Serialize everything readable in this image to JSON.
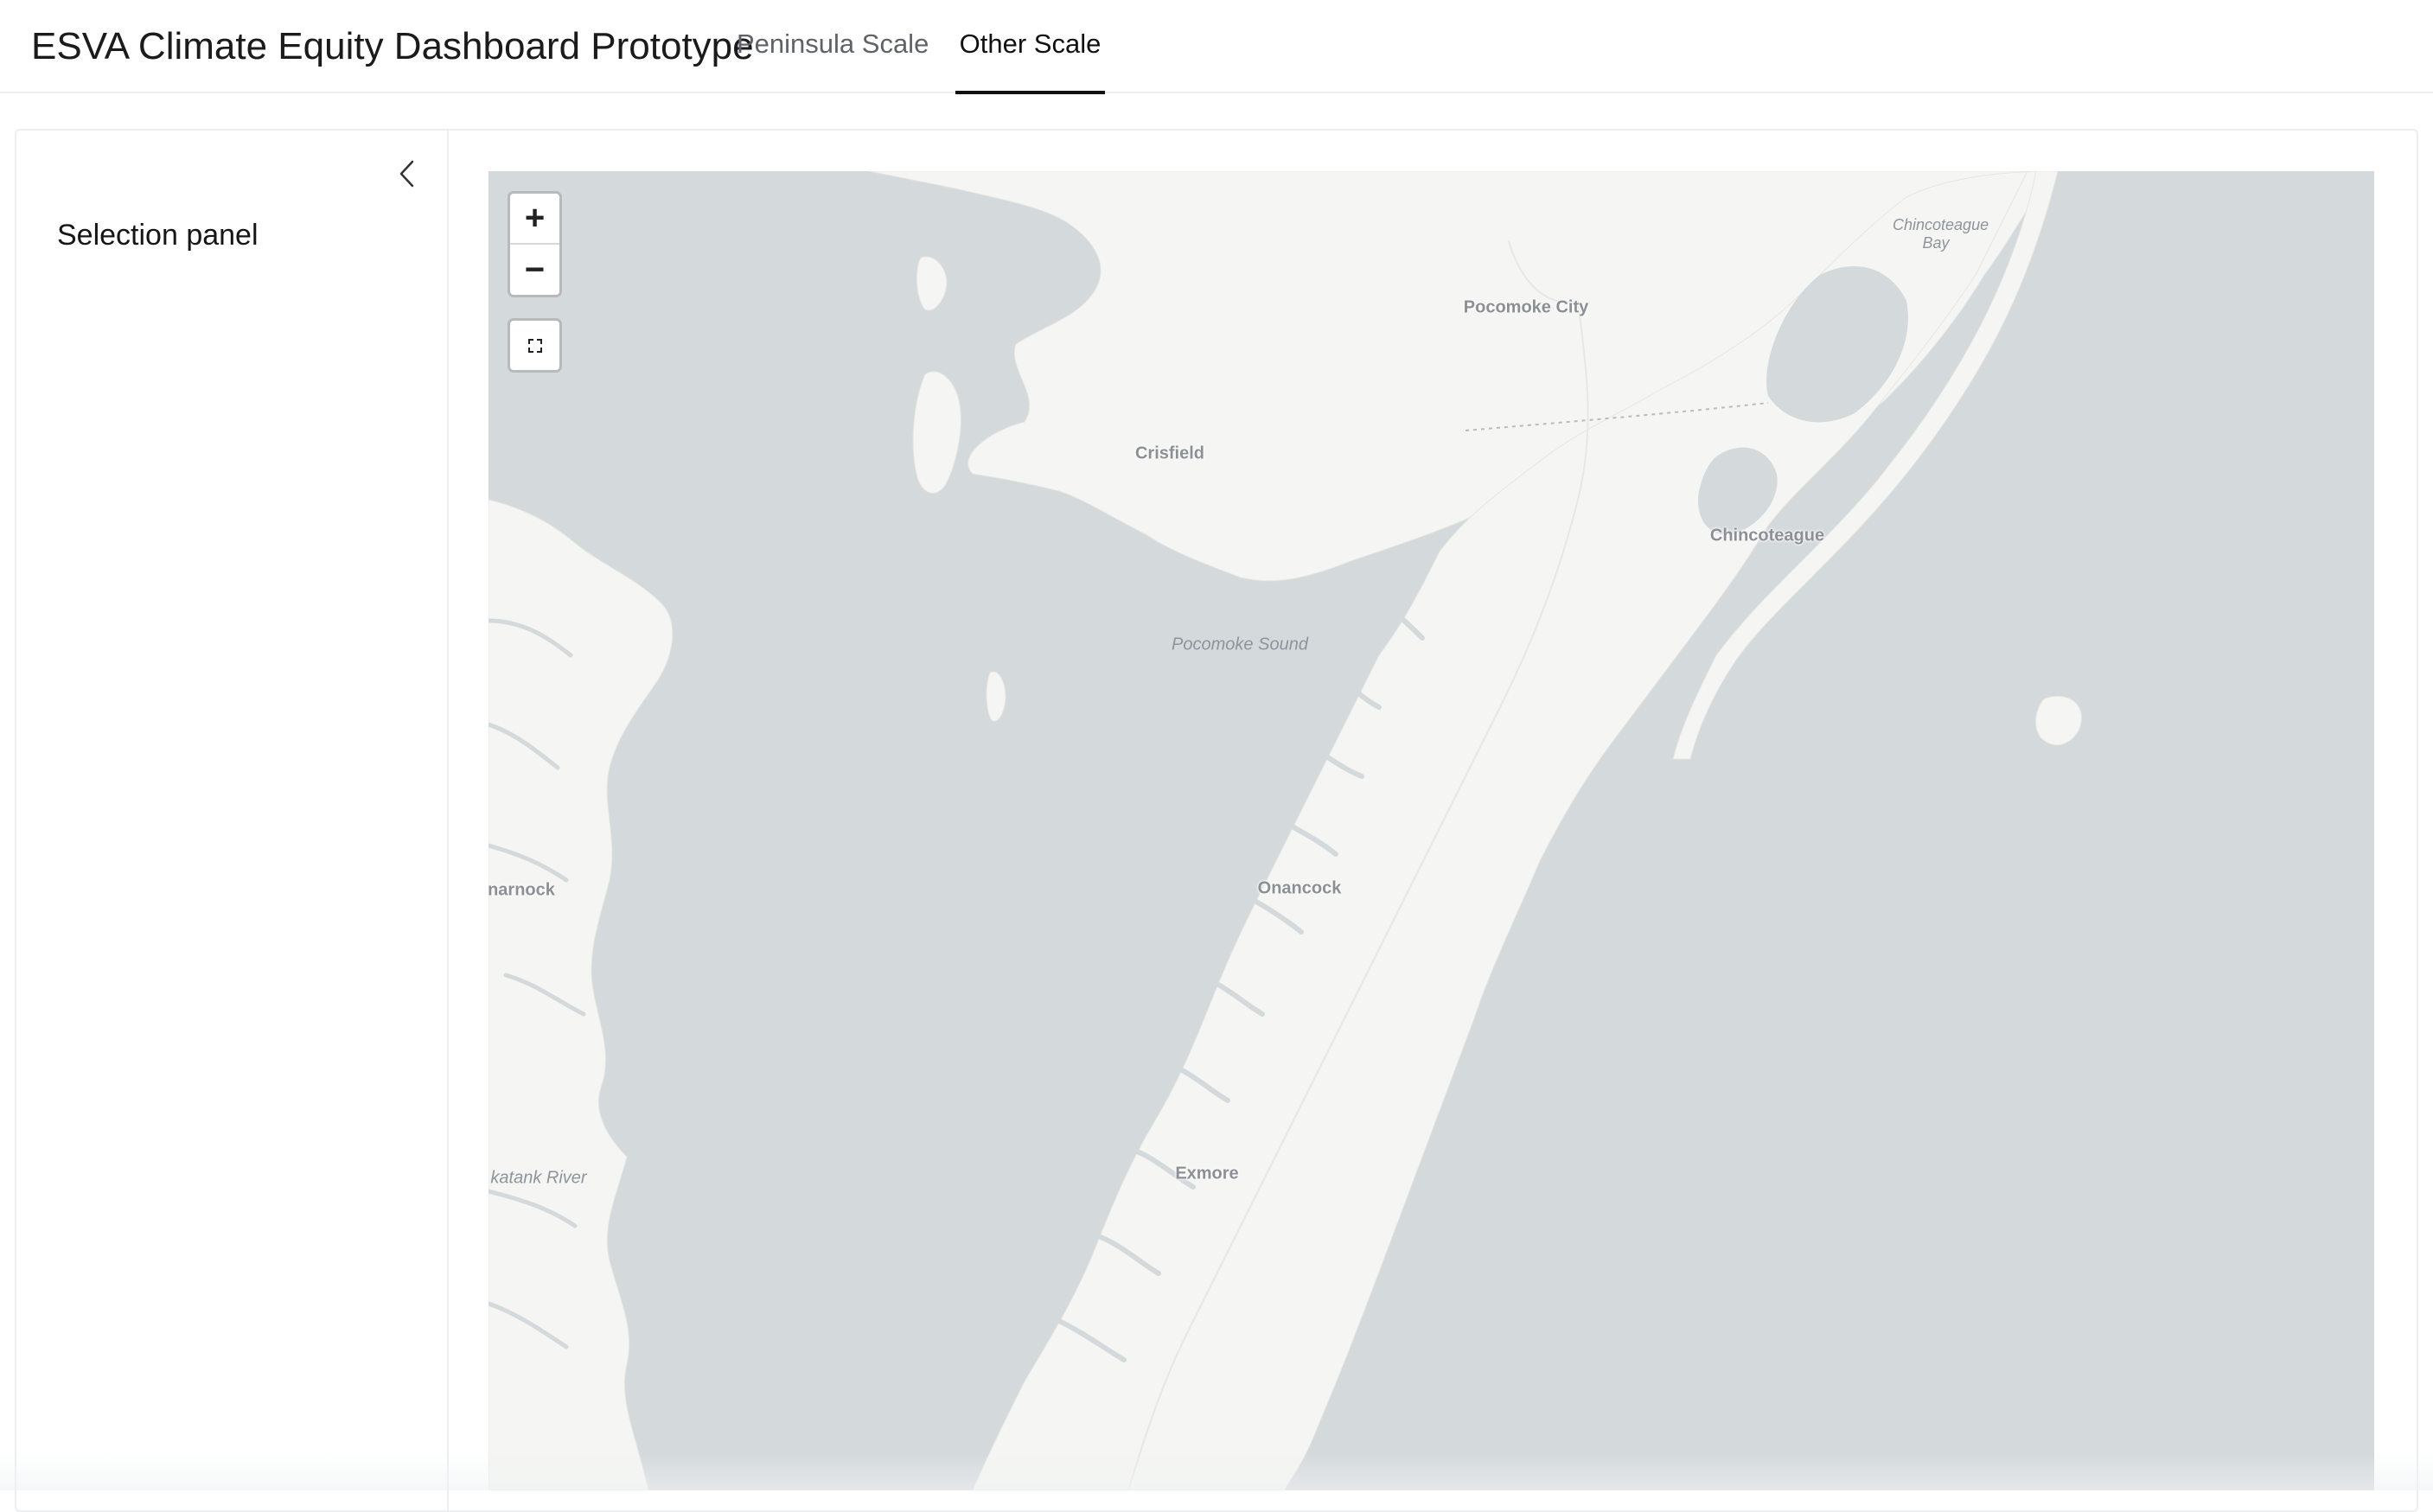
{
  "header": {
    "app_title": "ESVA Climate Equity Dashboard Prototype",
    "tabs": [
      {
        "label": "Peninsula Scale",
        "active": false
      },
      {
        "label": "Other Scale",
        "active": true
      }
    ]
  },
  "sidebar": {
    "title": "Selection panel",
    "collapse_icon": "chevron-left-icon"
  },
  "map": {
    "controls": {
      "zoom_in": "+",
      "zoom_out": "−",
      "fullscreen_icon": "fullscreen-icon"
    },
    "colors": {
      "water": "#d4d9dc",
      "land": "#f5f5f3"
    },
    "places": [
      {
        "name": "Pocomoke City",
        "kind": "town"
      },
      {
        "name": "Crisfield",
        "kind": "town"
      },
      {
        "name": "Chincoteague",
        "kind": "town"
      },
      {
        "name": "Chincoteague Bay",
        "kind": "water"
      },
      {
        "name": "Pocomoke Sound",
        "kind": "water"
      },
      {
        "name": "Onancock",
        "kind": "town"
      },
      {
        "name": "Exmore",
        "kind": "town"
      },
      {
        "name": "narnock",
        "kind": "town"
      },
      {
        "name": "katank River",
        "kind": "water"
      }
    ]
  }
}
